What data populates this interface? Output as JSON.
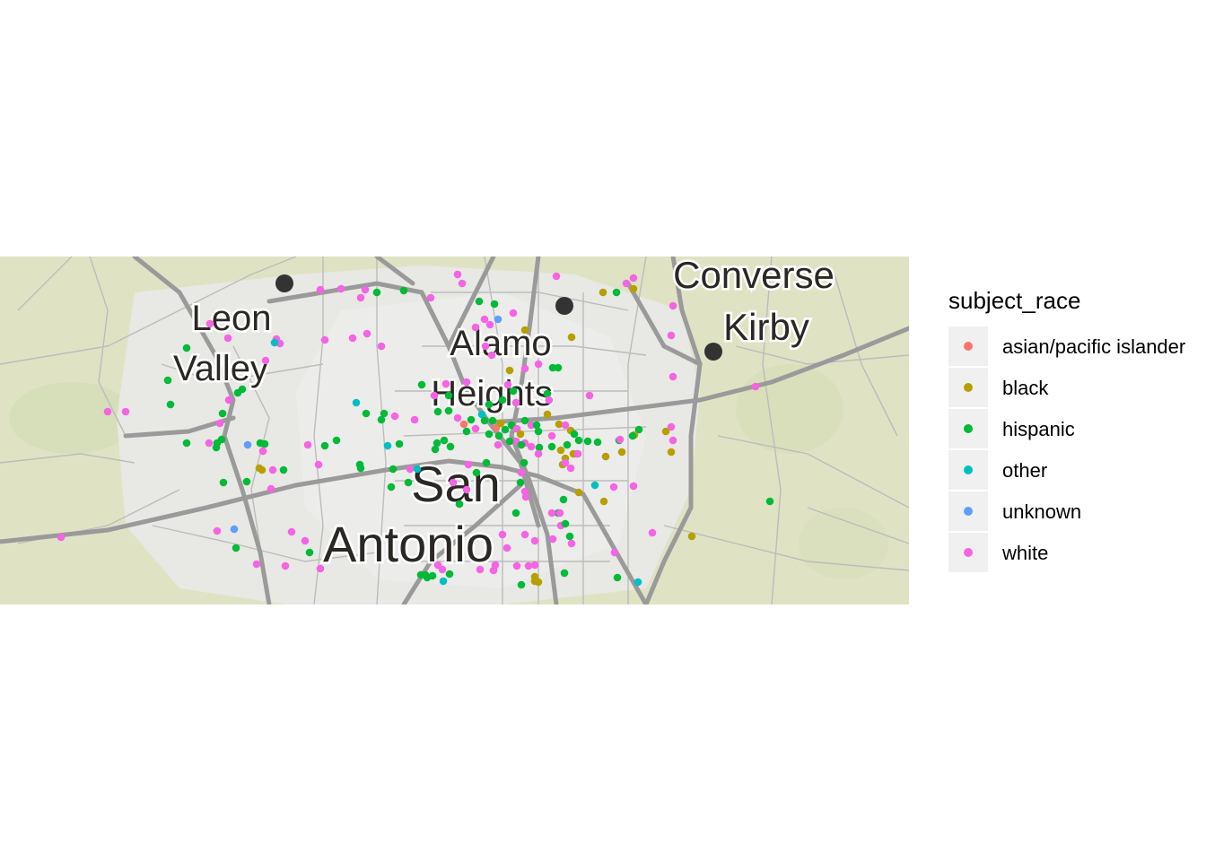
{
  "map": {
    "places": [
      {
        "id": "leon",
        "label": "Leon"
      },
      {
        "id": "valley",
        "label": "Valley"
      },
      {
        "id": "alamo",
        "label": "Alamo"
      },
      {
        "id": "heights",
        "label": "Heights"
      },
      {
        "id": "converse",
        "label": "Converse"
      },
      {
        "id": "kirby",
        "label": "Kirby"
      },
      {
        "id": "san",
        "label": "San"
      },
      {
        "id": "antonio",
        "label": "Antonio"
      }
    ],
    "colors": {
      "land": "#dfe3c4",
      "city": "#e9e9e6",
      "major_road": "#9c9c9c",
      "minor_road": "#bcbcbc",
      "city_marker": "#333333"
    }
  },
  "legend": {
    "title": "subject_race",
    "items": [
      {
        "label": "asian/pacific islander",
        "color": "#F8766D"
      },
      {
        "label": "black",
        "color": "#B79F00"
      },
      {
        "label": "hispanic",
        "color": "#00BA38"
      },
      {
        "label": "other",
        "color": "#00BFC4"
      },
      {
        "label": "unknown",
        "color": "#619CFF"
      },
      {
        "label": "white",
        "color": "#F564E3"
      }
    ]
  }
}
